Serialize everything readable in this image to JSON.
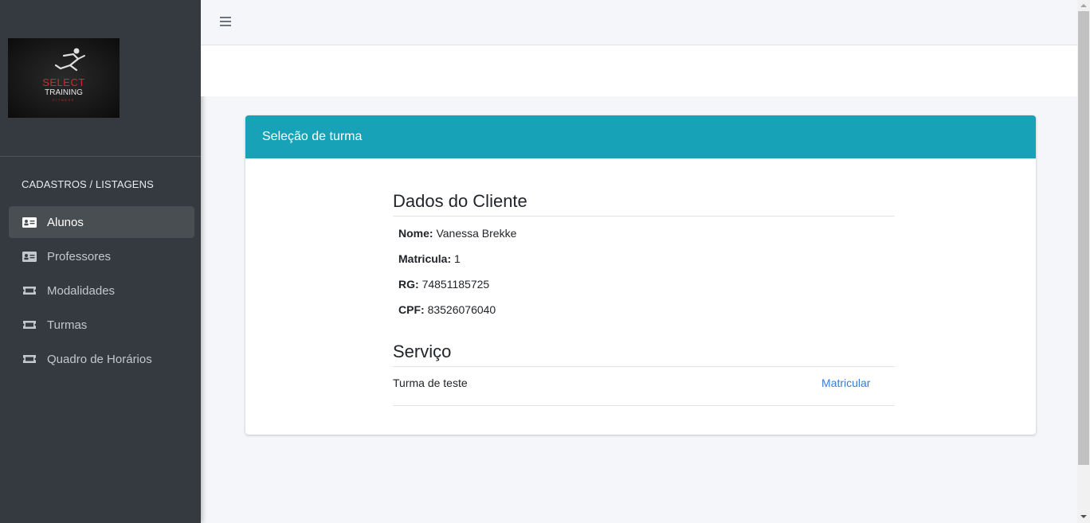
{
  "brand": {
    "logo_text_1": "SELECT",
    "logo_text_2": "TRAINING",
    "logo_text_3": "FITNESS"
  },
  "sidebar": {
    "header": "CADASTROS / LISTAGENS",
    "items": [
      {
        "label": "Alunos",
        "icon": "id-card-icon",
        "active": true
      },
      {
        "label": "Professores",
        "icon": "id-card-icon",
        "active": false
      },
      {
        "label": "Modalidades",
        "icon": "ticket-icon",
        "active": false
      },
      {
        "label": "Turmas",
        "icon": "ticket-icon",
        "active": false
      },
      {
        "label": "Quadro de Horários",
        "icon": "ticket-icon",
        "active": false
      }
    ]
  },
  "topbar": {
    "menu_icon": "hamburger-icon"
  },
  "card": {
    "title": "Seleção de turma",
    "client_section": {
      "title": "Dados do Cliente",
      "fields": [
        {
          "label": "Nome:",
          "value": "Vanessa Brekke"
        },
        {
          "label": "Matricula:",
          "value": "1"
        },
        {
          "label": "RG:",
          "value": "74851185725"
        },
        {
          "label": "CPF:",
          "value": "83526076040"
        }
      ]
    },
    "service_section": {
      "title": "Serviço",
      "service_name": "Turma de teste",
      "action_label": "Matricular"
    }
  },
  "colors": {
    "sidebar": "#343a40",
    "card_header": "#17a2b8",
    "link": "#3a7bd5",
    "background": "#f4f6f9"
  }
}
